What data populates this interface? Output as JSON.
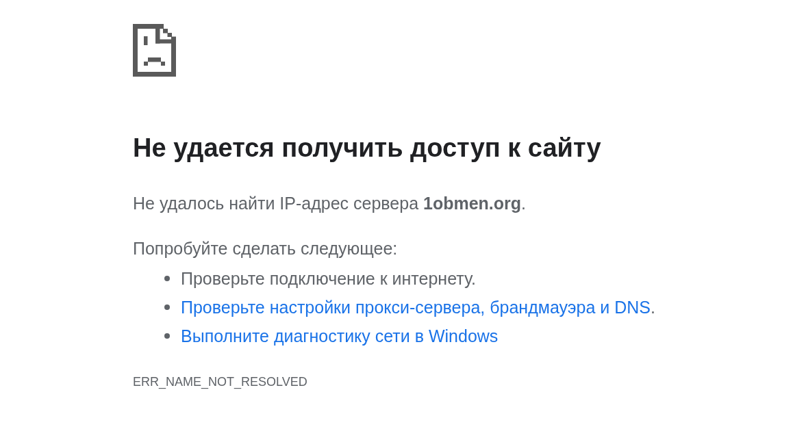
{
  "heading": "Не удается получить доступ к сайту",
  "summary": "Не удалось найти IP-адрес сервера **1obmen.org**.",
  "suggestions_intro": "Попробуйте сделать следующее:",
  "suggestions": [
    {
      "kind": "text",
      "text": "Проверьте подключение к интернету."
    },
    {
      "kind": "link",
      "text": "Проверьте настройки прокси-сервера, брандмауэра и DNS",
      "suffix": "."
    },
    {
      "kind": "link",
      "text": "Выполните диагностику сети в Windows"
    }
  ],
  "error_code": "ERR_NAME_NOT_RESOLVED"
}
